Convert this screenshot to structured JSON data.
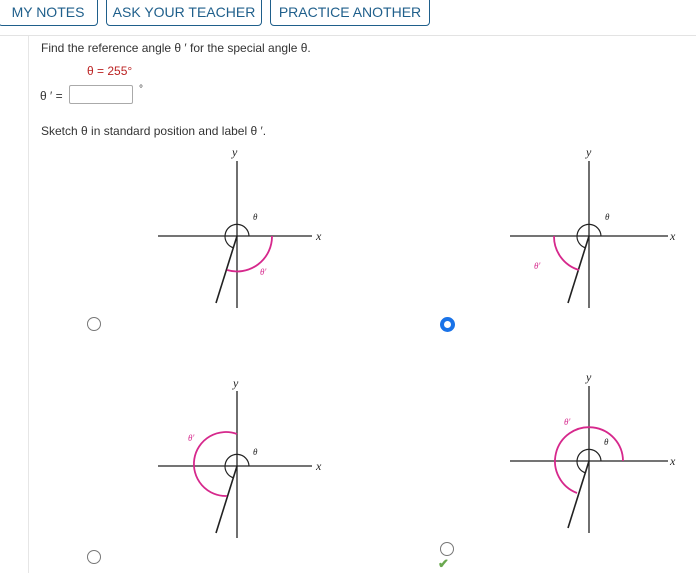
{
  "toolbar": {
    "my_notes": "MY NOTES",
    "ask_teacher": "ASK YOUR TEACHER",
    "practice_another": "PRACTICE ANOTHER"
  },
  "question": {
    "prompt": "Find the reference angle θ ′ for the special angle θ.",
    "given": "θ = 255°",
    "answer_label": "θ ′ =",
    "answer_value": "",
    "degree_symbol": "°",
    "sketch_prompt": "Sketch θ in standard position and label θ ′."
  },
  "graph_labels": {
    "x": "x",
    "y": "y",
    "theta": "θ",
    "theta_prime": "θ'"
  },
  "options": [
    {
      "id": "A",
      "selected": false,
      "correct": false
    },
    {
      "id": "B",
      "selected": true,
      "correct": false
    },
    {
      "id": "C",
      "selected": false,
      "correct": false
    },
    {
      "id": "D",
      "selected": false,
      "correct": true
    }
  ],
  "colors": {
    "accent": "#1f5f8b",
    "reference_arc": "#d6288c",
    "selected_radio": "#1a73e8",
    "correct_mark": "#6aa84f"
  },
  "icons": {
    "correct": "check-icon"
  },
  "correct_mark": "✔"
}
